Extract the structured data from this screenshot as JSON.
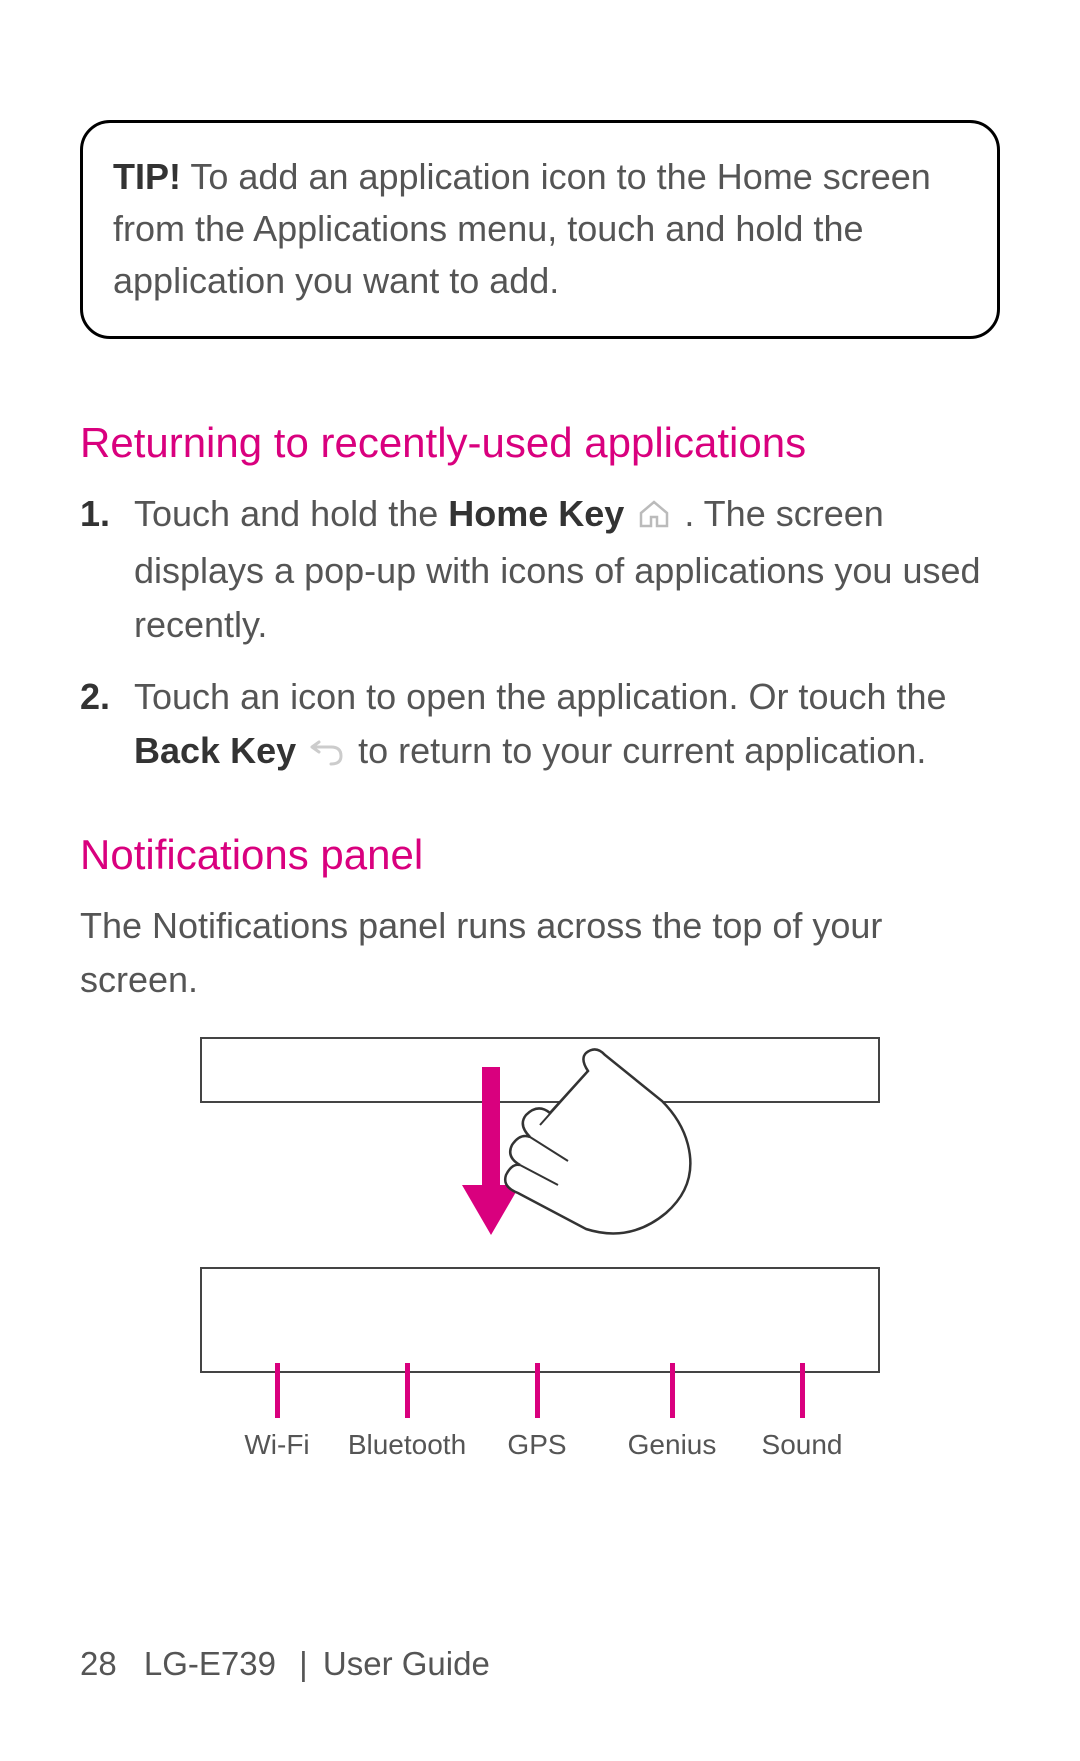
{
  "tip": {
    "label": "TIP!",
    "text": " To add an application icon to the Home screen from the Applications menu, touch and hold the application you want to add."
  },
  "section1": {
    "heading": "Returning to recently-used applications",
    "items": {
      "i1": {
        "num": "1.",
        "a": "Touch and hold the ",
        "strong": "Home Key",
        "b": " . The screen displays a pop-up with icons of applications you used recently."
      },
      "i2": {
        "num": "2.",
        "a": "Touch an icon to open the application. Or touch the ",
        "strong": "Back Key",
        "b": "  to return to your current application."
      }
    }
  },
  "section2": {
    "heading": "Notifications panel",
    "para": "The Notifications panel runs across the top of your screen."
  },
  "diagram": {
    "labels": {
      "l0": "Wi-Fi",
      "l1": "Bluetooth",
      "l2": "GPS",
      "l3": "Genius",
      "l4": "Sound"
    }
  },
  "footer": {
    "page": "28",
    "model": "LG-E739",
    "sep": "|",
    "title": "User Guide"
  }
}
